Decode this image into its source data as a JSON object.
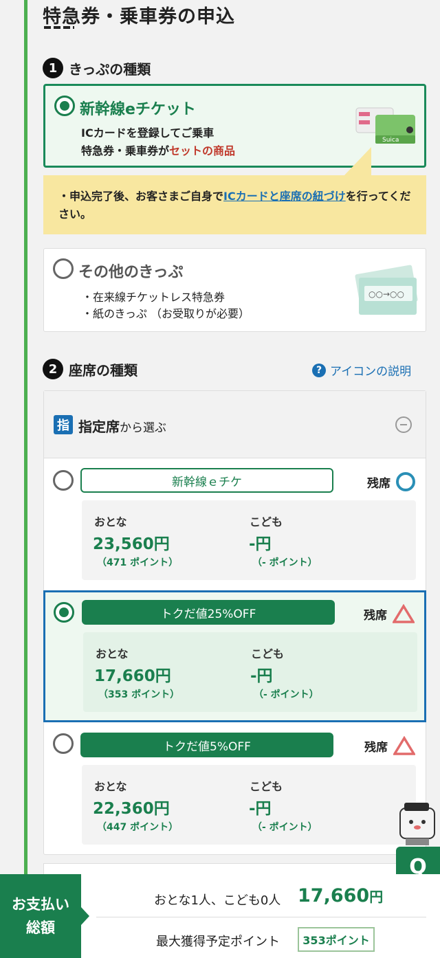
{
  "page": {
    "title": "特急券・乗車券の申込"
  },
  "ticket_section": {
    "num": "1",
    "label": "きっぷの種類",
    "option1": {
      "title": "新幹線eチケット",
      "line1": "ICカードを登録してご乗車",
      "line2_prefix": "特急券・乗車券が",
      "line2_red": "セットの商品"
    },
    "notice": {
      "prefix": "・申込完了後、お客さまご自身で",
      "link": "ICカードと座席の紐づけ",
      "suffix": "を行ってください。"
    },
    "option2": {
      "title": "その他のきっぷ",
      "line1": "・在来線チケットレス特急券",
      "line2": "・紙のきっぷ （お受取りが必要）",
      "ticket_text": "○○→○○"
    }
  },
  "seat_section": {
    "num": "2",
    "label": "座席の種類",
    "help_link": "アイコンの説明",
    "reserved": {
      "badge": "指",
      "label_bold": "指定席",
      "label_rest": "から選ぶ"
    },
    "remaining_label": "残席",
    "fares": [
      {
        "tag": "新幹線ｅチケ",
        "adult_label": "おとな",
        "adult_price": "23,560円",
        "adult_points": "（471 ポイント）",
        "child_label": "こども",
        "child_price": "-円",
        "child_points": "（- ポイント）",
        "availability": "circle"
      },
      {
        "tag": "トクだ値25%OFF",
        "adult_label": "おとな",
        "adult_price": "17,660円",
        "adult_points": "（353 ポイント）",
        "child_label": "こども",
        "child_price": "-円",
        "child_points": "（- ポイント）",
        "availability": "triangle"
      },
      {
        "tag": "トクだ値5%OFF",
        "adult_label": "おとな",
        "adult_price": "22,360円",
        "adult_points": "（447 ポイント）",
        "child_label": "こども",
        "child_price": "-円",
        "child_points": "（- ポイント）",
        "availability": "triangle"
      }
    ]
  },
  "footer": {
    "pay_line1": "お支払い",
    "pay_line2": "総額",
    "people": "おとな1人、こども0人",
    "total": "17,660",
    "total_unit": "円",
    "points_label": "最大獲得予定ポイント",
    "points_value": "353ポイント"
  },
  "chat_button": {
    "label": "Q"
  },
  "colors": {
    "accent": "#1a7f4e",
    "notice": "#f8e7a0",
    "red_text": "#c0392b",
    "warn": "#e26b6b",
    "link": "#1a6fb3"
  }
}
